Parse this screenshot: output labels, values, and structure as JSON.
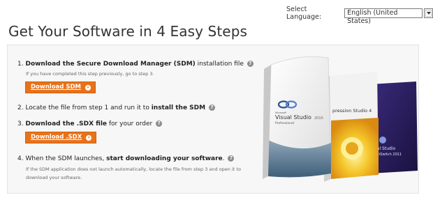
{
  "language": {
    "label": "Select Language:",
    "selected": "English (United States)"
  },
  "page_title": "Get Your Software in 4 Easy Steps",
  "steps": [
    {
      "number": "1.",
      "bold": "Download the Secure Download Manager (SDM)",
      "rest": " installation file",
      "note": "If you have completed this step previously, go to step 3.",
      "button": "Download SDM"
    },
    {
      "number": "2.",
      "pre": "Locate the file from step 1 and run it to ",
      "bold": "install the SDM"
    },
    {
      "number": "3.",
      "bold": "Download the .SDX file",
      "rest": " for your order",
      "button": "Download .SDX"
    },
    {
      "number": "4.",
      "pre": "When the SDM launches, ",
      "bold": "start downloading your software",
      "rest": ".",
      "note_line1": "If the SDM application does not launch automatically, locate the file from step 3 and open it to",
      "note_line2": "download your software."
    }
  ],
  "help_glyph": "?",
  "button_glyph": "»",
  "products": {
    "box1_brand": "Microsoft",
    "box1_name": "Visual Studio",
    "box1_version": "2010",
    "box1_edition": "Professional",
    "box2_name": "pression Studio 4",
    "box3_name": "ual Studio",
    "box3_sub": "ghtSwitch 2011"
  },
  "colors": {
    "button_orange": "#e8721a",
    "panel_bg": "#f7f7f7",
    "help_gray": "#8d8d8d"
  }
}
